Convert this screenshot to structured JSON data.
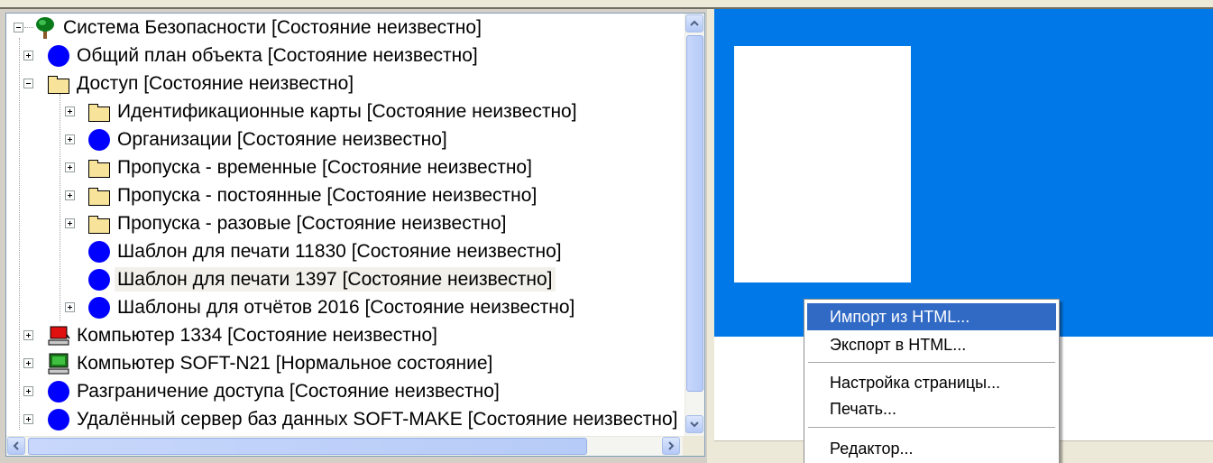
{
  "tree": {
    "items": [
      {
        "label": "Система Безопасности [Состояние неизвестно]",
        "icon": "tree-icon"
      },
      {
        "label": "Общий план объекта [Состояние неизвестно]",
        "icon": "circle-icon"
      },
      {
        "label": "Доступ [Состояние неизвестно]",
        "icon": "folder-icon"
      },
      {
        "label": "Идентификационные карты [Состояние неизвестно]",
        "icon": "folder-icon"
      },
      {
        "label": "Организации [Состояние неизвестно]",
        "icon": "circle-icon"
      },
      {
        "label": "Пропуска - временные [Состояние неизвестно]",
        "icon": "folder-icon"
      },
      {
        "label": "Пропуска - постоянные [Состояние неизвестно]",
        "icon": "folder-icon"
      },
      {
        "label": "Пропуска - разовые [Состояние неизвестно]",
        "icon": "folder-icon"
      },
      {
        "label": "Шаблон для печати 11830 [Состояние неизвестно]",
        "icon": "circle-icon"
      },
      {
        "label": "Шаблон для печати 1397 [Состояние неизвестно]",
        "icon": "circle-icon",
        "selected": true
      },
      {
        "label": "Шаблоны для отчётов 2016 [Состояние неизвестно]",
        "icon": "circle-icon"
      },
      {
        "label": "Компьютер 1334 [Состояние неизвестно]",
        "icon": "computer-offline-icon"
      },
      {
        "label": "Компьютер SOFT-N21 [Нормальное состояние]",
        "icon": "computer-online-icon"
      },
      {
        "label": "Разграничение доступа [Состояние неизвестно]",
        "icon": "circle-icon"
      },
      {
        "label": "Удалённый сервер баз данных SOFT-MAKE [Состояние неизвестно]",
        "icon": "circle-icon"
      }
    ]
  },
  "context_menu": {
    "items": [
      {
        "label": "Импорт из HTML..."
      },
      {
        "label": "Экспорт в HTML..."
      },
      {
        "label": "Настройка страницы..."
      },
      {
        "label": "Печать..."
      },
      {
        "label": "Редактор..."
      }
    ]
  },
  "colors": {
    "preview_background": "#0078e8",
    "menu_highlight": "#316ac5",
    "circle_icon": "#0000ff"
  }
}
